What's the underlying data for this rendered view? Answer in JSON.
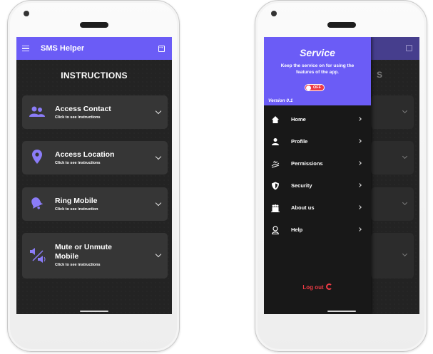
{
  "left_screen": {
    "app_title": "SMS Helper",
    "heading": "INSTRUCTIONS",
    "cards": [
      {
        "title": "Access Contact",
        "subtitle": "Click to see instructions",
        "icon": "contacts-icon"
      },
      {
        "title": "Access Location",
        "subtitle": "Click to see instructions",
        "icon": "location-pin-icon"
      },
      {
        "title": "Ring Mobile",
        "subtitle": "Click to see instruction",
        "icon": "bell-icon"
      },
      {
        "title": "Mute or Unmute Mobile",
        "title_line1": "Mute or Unmute",
        "title_line2": "Mobile",
        "subtitle": "Click to see instructions",
        "icon": "volume-mute-icon"
      }
    ]
  },
  "right_screen": {
    "background_heading_fragment": "S",
    "drawer": {
      "service_title": "Service",
      "service_description": "Keep the service on for using the features of the app.",
      "toggle_label": "OFF",
      "toggle_on": false,
      "version": "Version 0.1",
      "menu": [
        {
          "label": "Home",
          "icon": "home-icon"
        },
        {
          "label": "Profile",
          "icon": "person-icon"
        },
        {
          "label": "Permissions",
          "icon": "hand-icon"
        },
        {
          "label": "Security",
          "icon": "shield-icon"
        },
        {
          "label": "About us",
          "icon": "group-icon"
        },
        {
          "label": "Help",
          "icon": "help-icon"
        }
      ],
      "logout_label": "Log out"
    }
  },
  "colors": {
    "accent": "#6b5cf6",
    "screen_bg": "#232323",
    "card_bg": "#363636",
    "toggle_off": "#ef3b45",
    "logout": "#ef3b45"
  }
}
